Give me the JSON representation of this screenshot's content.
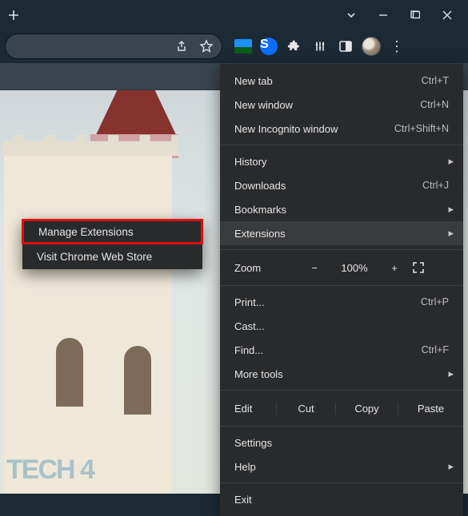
{
  "titlebar": {
    "newtab_tooltip": "New Tab"
  },
  "toolbar": {
    "extensions": [
      "desktop-wallpaper-ext",
      "shazam-ext",
      "extensions-puzzle",
      "media-control",
      "side-panel"
    ]
  },
  "submenu": {
    "manage": "Manage Extensions",
    "store": "Visit Chrome Web Store"
  },
  "menu": {
    "new_tab": {
      "label": "New tab",
      "shortcut": "Ctrl+T"
    },
    "new_window": {
      "label": "New window",
      "shortcut": "Ctrl+N"
    },
    "incognito": {
      "label": "New Incognito window",
      "shortcut": "Ctrl+Shift+N"
    },
    "history": {
      "label": "History"
    },
    "downloads": {
      "label": "Downloads",
      "shortcut": "Ctrl+J"
    },
    "bookmarks": {
      "label": "Bookmarks"
    },
    "extensions": {
      "label": "Extensions"
    },
    "zoom": {
      "label": "Zoom",
      "pct": "100%",
      "minus": "−",
      "plus": "+"
    },
    "print": {
      "label": "Print...",
      "shortcut": "Ctrl+P"
    },
    "cast": {
      "label": "Cast..."
    },
    "find": {
      "label": "Find...",
      "shortcut": "Ctrl+F"
    },
    "more_tools": {
      "label": "More tools"
    },
    "edit": {
      "label": "Edit",
      "cut": "Cut",
      "copy": "Copy",
      "paste": "Paste"
    },
    "settings": {
      "label": "Settings"
    },
    "help": {
      "label": "Help"
    },
    "exit": {
      "label": "Exit"
    }
  },
  "watermark": "TECH 4"
}
